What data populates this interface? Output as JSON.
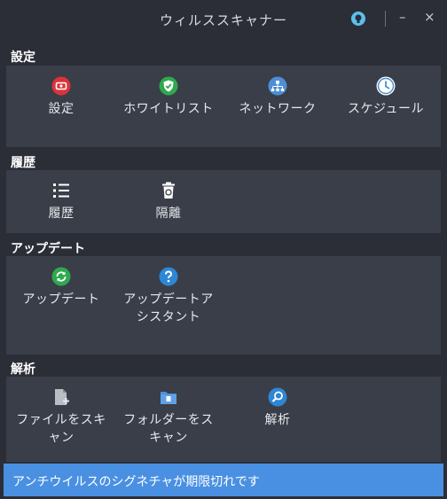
{
  "window": {
    "title": "ウィルススキャナー",
    "minimize": "–",
    "close": "×"
  },
  "sections": {
    "settings": {
      "heading": "設定",
      "items": [
        {
          "label": "設定",
          "icon": "settings-icon"
        },
        {
          "label": "ホワイトリスト",
          "icon": "whitelist-shield-icon"
        },
        {
          "label": "ネットワーク",
          "icon": "network-icon"
        },
        {
          "label": "スケジュール",
          "icon": "clock-icon"
        }
      ]
    },
    "history": {
      "heading": "履歴",
      "items": [
        {
          "label": "履歴",
          "icon": "list-icon"
        },
        {
          "label": "隔離",
          "icon": "trash-icon"
        }
      ]
    },
    "update": {
      "heading": "アップデート",
      "items": [
        {
          "label": "アップデート",
          "icon": "update-icon"
        },
        {
          "label": "アップデートアシスタント",
          "icon": "help-icon"
        }
      ]
    },
    "analysis": {
      "heading": "解析",
      "items": [
        {
          "label": "ファイルをスキャン",
          "icon": "file-scan-icon"
        },
        {
          "label": "フォルダーをスキャン",
          "icon": "folder-scan-icon"
        },
        {
          "label": "解析",
          "icon": "search-icon"
        }
      ]
    }
  },
  "status": {
    "message": "アンチウイルスのシグネチャが期限切れです"
  },
  "colors": {
    "statusbar": "#4a90e2",
    "panel": "#3a3e48",
    "background": "#2b2e37"
  }
}
